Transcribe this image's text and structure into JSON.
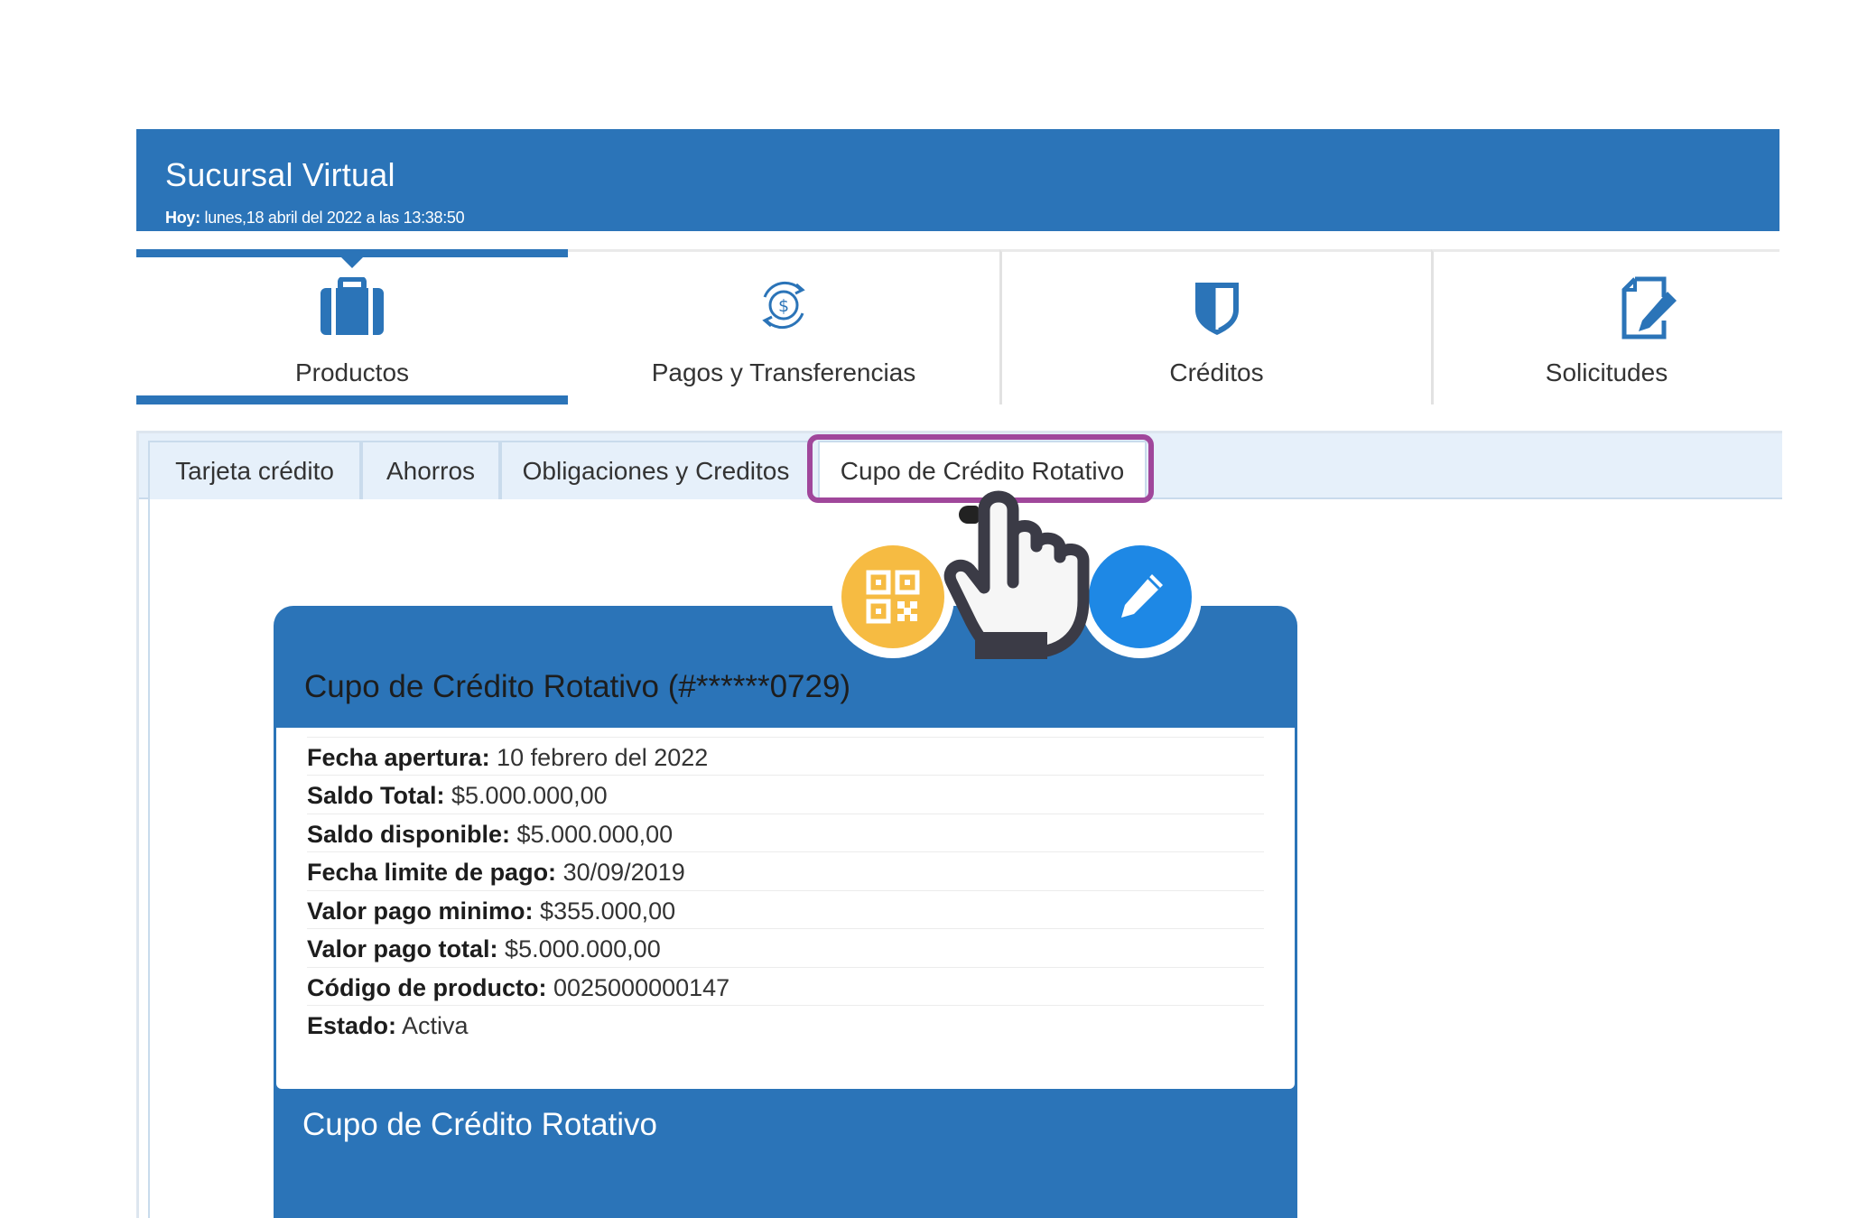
{
  "header": {
    "title": "Sucursal Virtual",
    "date_label": "Hoy:",
    "date_value": "lunes,18 abril del 2022 a las 13:38:50"
  },
  "main_nav": [
    {
      "label": "Productos",
      "icon": "briefcase-icon",
      "active": true
    },
    {
      "label": "Pagos y Transferencias",
      "icon": "money-exchange-icon"
    },
    {
      "label": "Créditos",
      "icon": "shield-icon"
    },
    {
      "label": "Solicitudes",
      "icon": "document-edit-icon"
    }
  ],
  "tabs": [
    {
      "label": "Tarjeta crédito"
    },
    {
      "label": "Ahorros"
    },
    {
      "label": "Obligaciones y Creditos"
    },
    {
      "label": "Cupo de Crédito Rotativo",
      "active": true
    }
  ],
  "card": {
    "title": "Cupo de Crédito Rotativo (#******0729)",
    "fields": [
      {
        "label": "Fecha apertura:",
        "value": "10 febrero del 2022"
      },
      {
        "label": "Saldo Total:",
        "value": "$5.000.000,00"
      },
      {
        "label": "Saldo disponible:",
        "value": "$5.000.000,00"
      },
      {
        "label": "Fecha limite de pago:",
        "value": "30/09/2019"
      },
      {
        "label": "Valor pago minimo:",
        "value": "$355.000,00"
      },
      {
        "label": "Valor pago total:",
        "value": "$5.000.000,00"
      },
      {
        "label": "Código de producto:",
        "value": "0025000000147"
      },
      {
        "label": "Estado:",
        "value": "Activa"
      }
    ],
    "footer_title": "Cupo de Crédito Rotativo",
    "actions": [
      {
        "icon": "qr-code-icon",
        "color": "#f6bb42"
      },
      {
        "icon": "pencil-icon",
        "color": "#1e88e5"
      }
    ]
  },
  "colors": {
    "brand_blue": "#2b74b8",
    "highlight": "#a0479b",
    "tab_bg": "#e6f0fa"
  }
}
